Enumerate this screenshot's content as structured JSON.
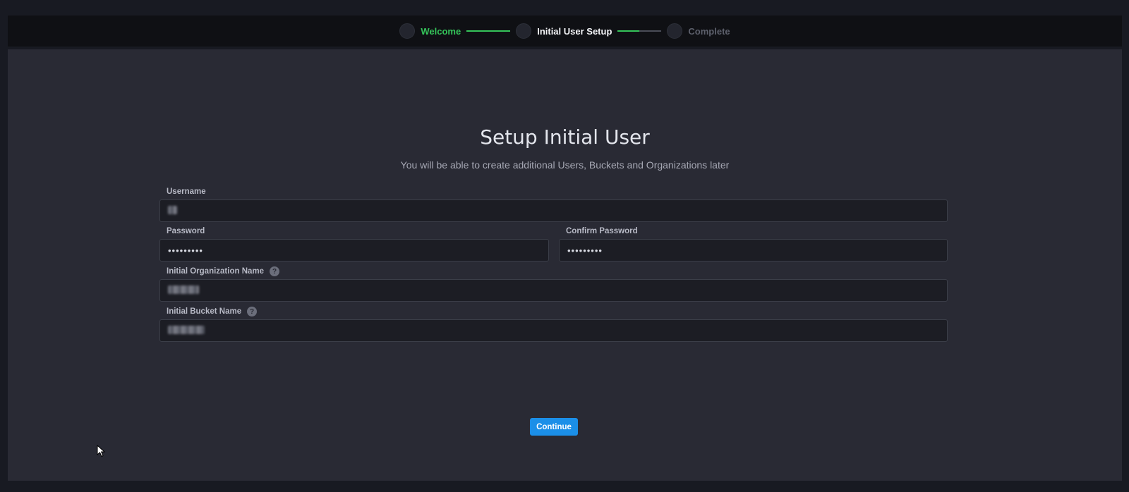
{
  "stepper": {
    "steps": [
      {
        "label": "Welcome",
        "state": "done"
      },
      {
        "label": "Initial User Setup",
        "state": "active"
      },
      {
        "label": "Complete",
        "state": "todo"
      }
    ],
    "connector_progress": [
      1.0,
      0.5
    ]
  },
  "form": {
    "title": "Setup Initial User",
    "subtitle": "You will be able to create additional Users, Buckets and Organizations later",
    "username": {
      "label": "Username",
      "value": ""
    },
    "password": {
      "label": "Password",
      "value": "•••••••••"
    },
    "confirm_password": {
      "label": "Confirm Password",
      "value": "•••••••••"
    },
    "org_name": {
      "label": "Initial Organization Name",
      "value": "",
      "help_icon": "question-circle-icon"
    },
    "bucket_name": {
      "label": "Initial Bucket Name",
      "value": "",
      "help_icon": "question-circle-icon"
    },
    "continue_label": "Continue"
  },
  "colors": {
    "accent_green": "#35c45a",
    "button_blue": "#1b8fe8",
    "panel_bg": "#292a34"
  }
}
